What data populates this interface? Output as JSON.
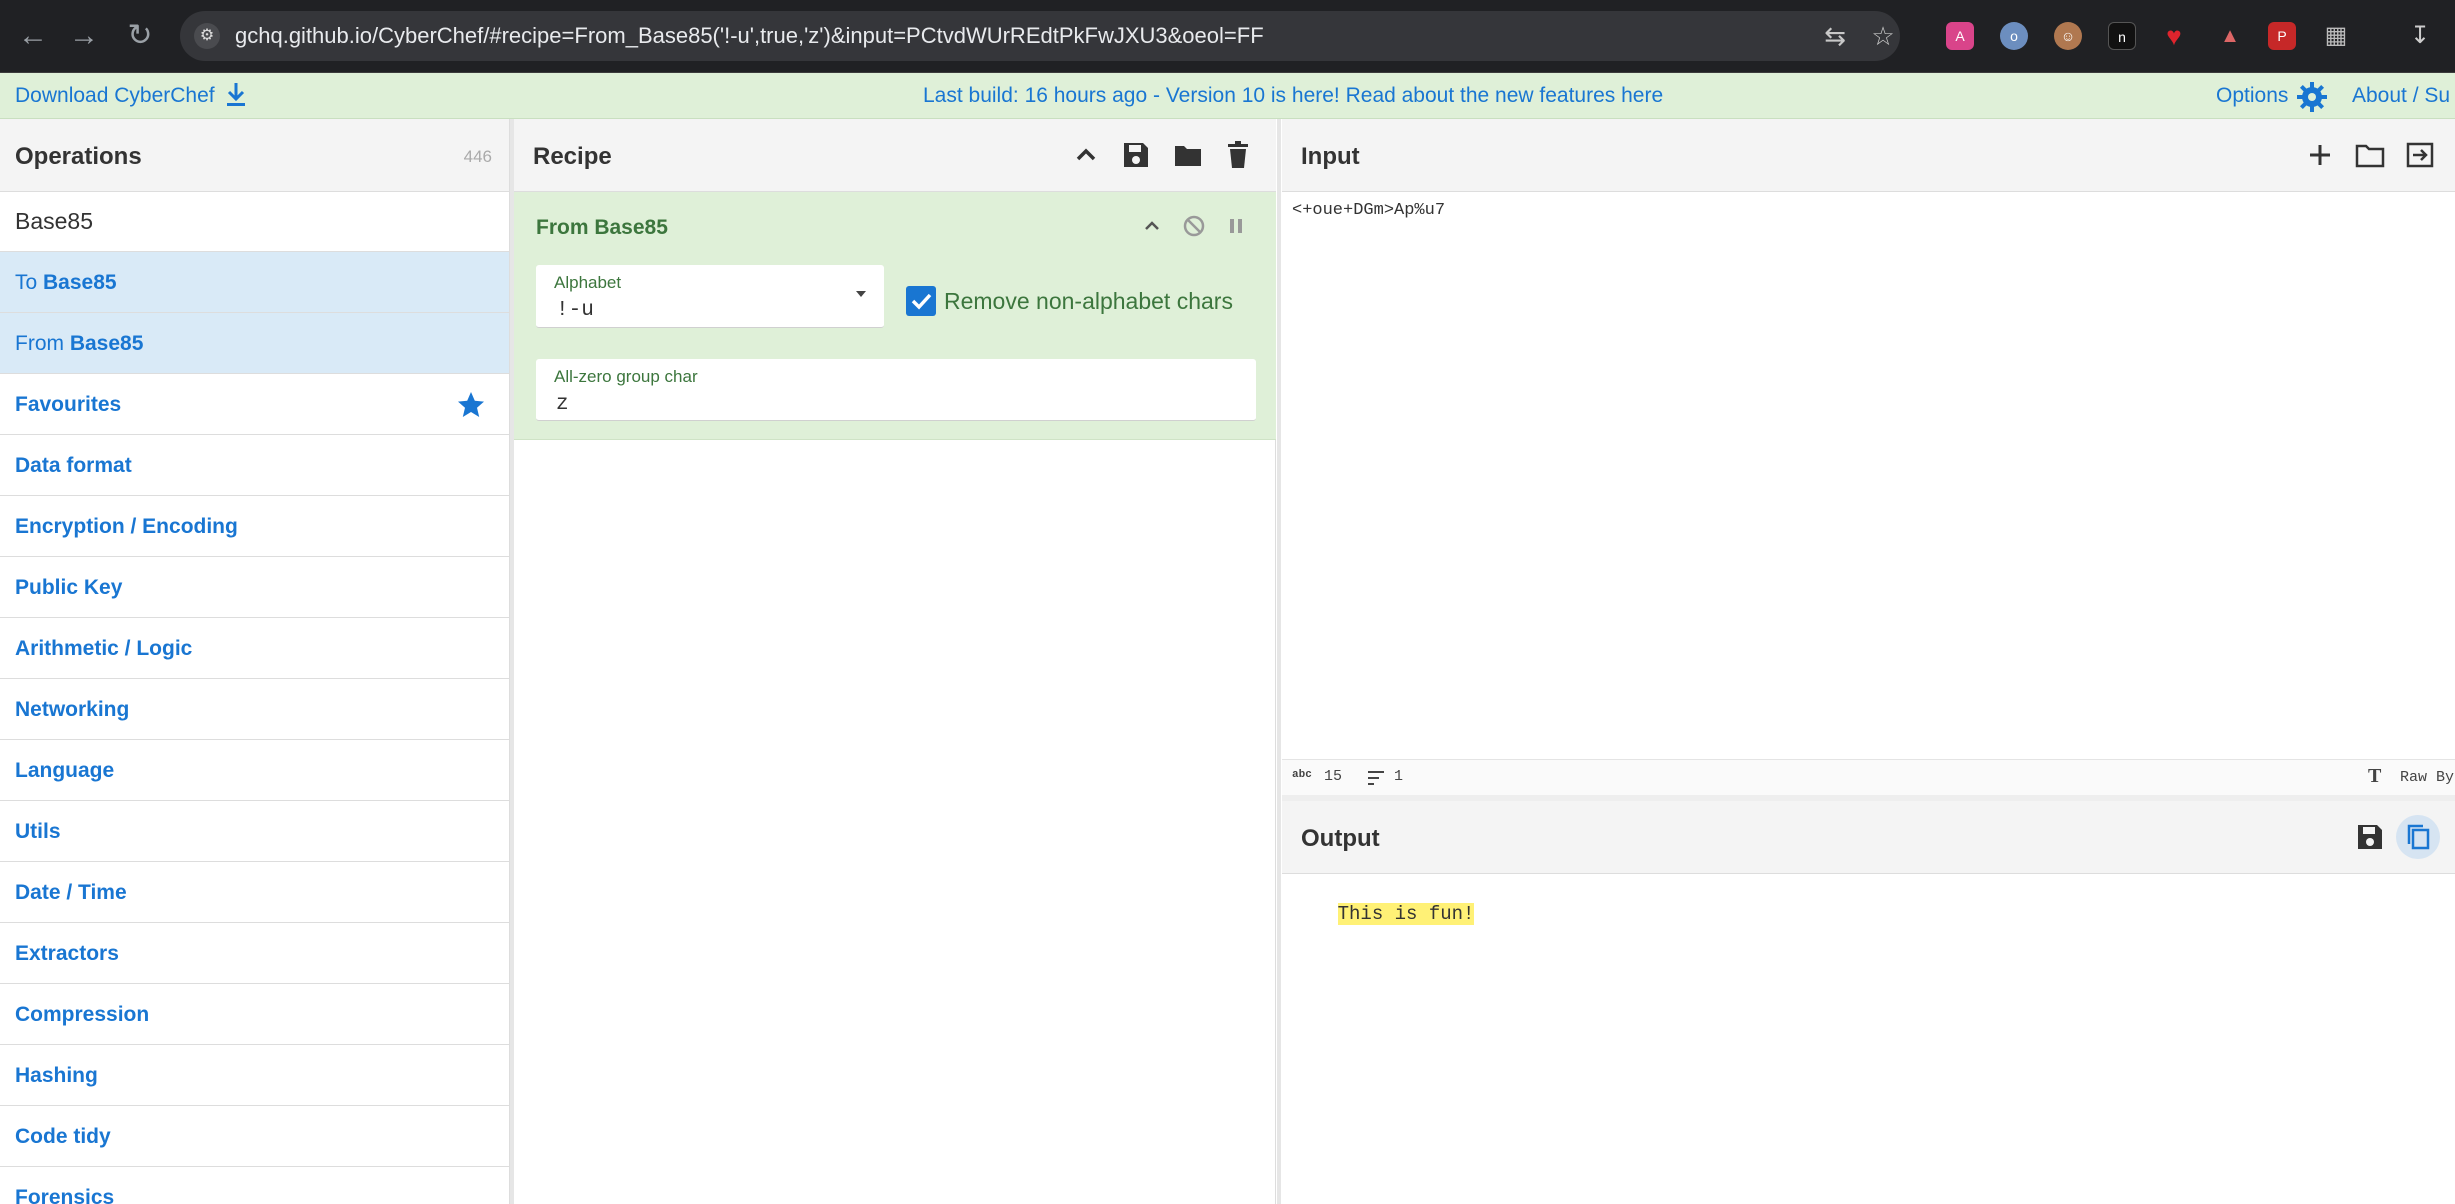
{
  "browser": {
    "url": "gchq.github.io/CyberChef/#recipe=From_Base85('!-u',true,'z')&input=PCtvdWUrREdtPkFwJXU3&oeol=FF"
  },
  "banner": {
    "download_label": "Download CyberChef",
    "notice": "Last build: 16 hours ago - Version 10 is here! Read about the new features here",
    "options_label": "Options",
    "about_label": "About / Su"
  },
  "operations": {
    "title": "Operations",
    "count": "446",
    "search_value": "Base85",
    "search_results": [
      {
        "prefix": "To ",
        "match": "Base85"
      },
      {
        "prefix": "From ",
        "match": "Base85"
      }
    ],
    "categories": [
      "Favourites",
      "Data format",
      "Encryption / Encoding",
      "Public Key",
      "Arithmetic / Logic",
      "Networking",
      "Language",
      "Utils",
      "Date / Time",
      "Extractors",
      "Compression",
      "Hashing",
      "Code tidy",
      "Forensics"
    ]
  },
  "recipe": {
    "title": "Recipe",
    "operation": {
      "name": "From Base85",
      "alphabet_label": "Alphabet",
      "alphabet_value": "!-u",
      "remove_label": "Remove non-alphabet chars",
      "remove_checked": true,
      "allzero_label": "All-zero group char",
      "allzero_value": "z"
    }
  },
  "input": {
    "title": "Input",
    "text": "<+oue+DGm>Ap%u7",
    "char_count": "15",
    "line_count": "1",
    "raw_label": "Raw By"
  },
  "output": {
    "title": "Output",
    "text": "This is fun!"
  },
  "colors": {
    "accent": "#1976d2",
    "recipe_green": "#dff0d8",
    "recipe_text": "#3c763d",
    "highlight": "#fff176"
  }
}
